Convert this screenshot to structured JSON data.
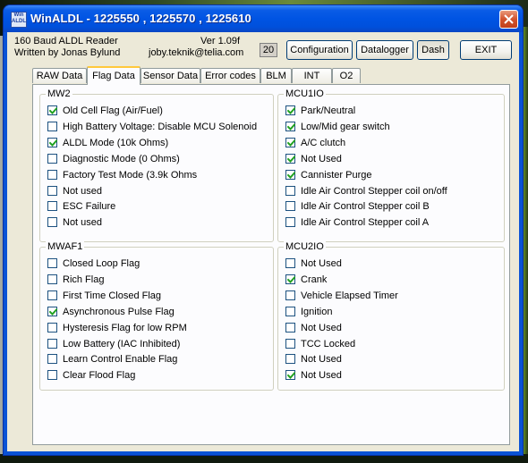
{
  "window": {
    "title": "WinALDL - 1225550 , 1225570 , 1225610",
    "icon_text": "Win ALDL",
    "close_icon": "close-icon"
  },
  "header": {
    "app_name": "160 Baud ALDL Reader",
    "author": "Written by Jonas Bylund",
    "version": "Ver 1.09f",
    "email": "joby.teknik@telia.com",
    "counter": "20"
  },
  "buttons": {
    "configuration": "Configuration",
    "datalogger": "Datalogger",
    "dash": "Dash",
    "exit": "EXIT"
  },
  "tabs": [
    "RAW Data",
    "Flag Data",
    "Sensor Data",
    "Error codes",
    "BLM",
    "INT",
    "O2"
  ],
  "active_tab": "Flag Data",
  "groups": {
    "mw2": {
      "title": "MW2",
      "items": [
        {
          "label": "Old Cell Flag (Air/Fuel)",
          "checked": true
        },
        {
          "label": "High Battery Voltage: Disable MCU Solenoid",
          "checked": false
        },
        {
          "label": "ALDL Mode (10k Ohms)",
          "checked": true
        },
        {
          "label": "Diagnostic Mode (0 Ohms)",
          "checked": false
        },
        {
          "label": "Factory Test Mode (3.9k Ohms",
          "checked": false
        },
        {
          "label": "Not used",
          "checked": false
        },
        {
          "label": "ESC Failure",
          "checked": false
        },
        {
          "label": "Not used",
          "checked": false
        }
      ]
    },
    "mcu1io": {
      "title": "MCU1IO",
      "items": [
        {
          "label": "Park/Neutral",
          "checked": true
        },
        {
          "label": "Low/Mid gear switch",
          "checked": true
        },
        {
          "label": "A/C clutch",
          "checked": true
        },
        {
          "label": "Not Used",
          "checked": true
        },
        {
          "label": "Cannister Purge",
          "checked": true
        },
        {
          "label": "Idle Air Control Stepper coil on/off",
          "checked": false
        },
        {
          "label": "Idle Air Control Stepper coil B",
          "checked": false
        },
        {
          "label": "Idle Air Control Stepper coil A",
          "checked": false
        }
      ]
    },
    "mwaf1": {
      "title": "MWAF1",
      "items": [
        {
          "label": "Closed Loop Flag",
          "checked": false
        },
        {
          "label": "Rich Flag",
          "checked": false
        },
        {
          "label": "First Time Closed Flag",
          "checked": false
        },
        {
          "label": "Asynchronous Pulse Flag",
          "checked": true
        },
        {
          "label": "Hysteresis Flag for low RPM",
          "checked": false
        },
        {
          "label": "Low Battery (IAC Inhibited)",
          "checked": false
        },
        {
          "label": "Learn Control Enable Flag",
          "checked": false
        },
        {
          "label": "Clear Flood Flag",
          "checked": false
        }
      ]
    },
    "mcu2io": {
      "title": "MCU2IO",
      "items": [
        {
          "label": "Not Used",
          "checked": false
        },
        {
          "label": "Crank",
          "checked": true
        },
        {
          "label": "Vehicle Elapsed Timer",
          "checked": false
        },
        {
          "label": "Ignition",
          "checked": false
        },
        {
          "label": "Not Used",
          "checked": false
        },
        {
          "label": "TCC Locked",
          "checked": false
        },
        {
          "label": "Not Used",
          "checked": false
        },
        {
          "label": "Not Used",
          "checked": true
        }
      ]
    }
  },
  "colors": {
    "titlebar": "#0054e3",
    "face": "#ece9d8",
    "tab_highlight": "#ffc83c",
    "close_button": "#d2532e"
  }
}
